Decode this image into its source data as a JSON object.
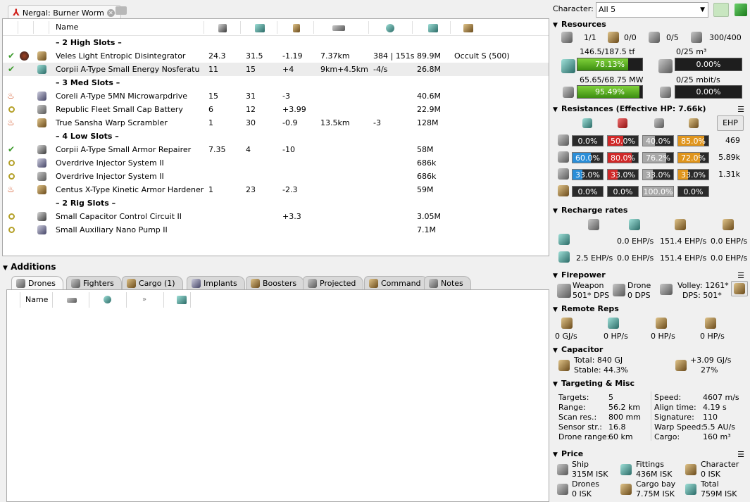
{
  "fit_tab": {
    "title": "Nergal: Burner Worm"
  },
  "columns": {
    "name": "Name"
  },
  "rows": [
    {
      "type": "slot",
      "label": "– 2 High Slots –"
    },
    {
      "type": "mod",
      "state": "ok",
      "name": "Veles Light Entropic Disintegrator",
      "c1": "24.3",
      "c2": "31.5",
      "c3": "-1.19",
      "c4": "7.37km",
      "c5": "384 | 151s",
      "c6": "89.9M",
      "c7": "Occult S (500)"
    },
    {
      "type": "mod",
      "state": "ok",
      "sel": true,
      "name": "Corpii A-Type Small Energy Nosferatu",
      "c1": "11",
      "c2": "15",
      "c3": "+4",
      "c4": "9km+4.5km",
      "c5": "-4/s",
      "c6": "26.8M",
      "c7": ""
    },
    {
      "type": "slot",
      "label": "– 3 Med Slots –"
    },
    {
      "type": "mod",
      "state": "ovl",
      "name": "Coreli A-Type 5MN Microwarpdrive",
      "c1": "15",
      "c2": "31",
      "c3": "-3",
      "c4": "",
      "c5": "",
      "c6": "40.6M",
      "c7": ""
    },
    {
      "type": "mod",
      "state": "off",
      "name": "Republic Fleet Small Cap Battery",
      "c1": "6",
      "c2": "12",
      "c3": "+3.99",
      "c4": "",
      "c5": "",
      "c6": "22.9M",
      "c7": ""
    },
    {
      "type": "mod",
      "state": "ovl",
      "name": "True Sansha Warp Scrambler",
      "c1": "1",
      "c2": "30",
      "c3": "-0.9",
      "c4": "13.5km",
      "c5": "-3",
      "c6": "128M",
      "c7": ""
    },
    {
      "type": "slot",
      "label": "– 4 Low Slots –"
    },
    {
      "type": "mod",
      "state": "ok",
      "name": "Corpii A-Type Small Armor Repairer",
      "c1": "7.35",
      "c2": "4",
      "c3": "-10",
      "c4": "",
      "c5": "",
      "c6": "58M",
      "c7": ""
    },
    {
      "type": "mod",
      "state": "off",
      "name": "Overdrive Injector System II",
      "c1": "",
      "c2": "",
      "c3": "",
      "c4": "",
      "c5": "",
      "c6": "686k",
      "c7": ""
    },
    {
      "type": "mod",
      "state": "off",
      "name": "Overdrive Injector System II",
      "c1": "",
      "c2": "",
      "c3": "",
      "c4": "",
      "c5": "",
      "c6": "686k",
      "c7": ""
    },
    {
      "type": "mod",
      "state": "ovl",
      "name": "Centus X-Type Kinetic Armor Hardener",
      "c1": "1",
      "c2": "23",
      "c3": "-2.3",
      "c4": "",
      "c5": "",
      "c6": "59M",
      "c7": ""
    },
    {
      "type": "slot",
      "label": "– 2 Rig Slots –"
    },
    {
      "type": "mod",
      "state": "off",
      "name": "Small Capacitor Control Circuit II",
      "c1": "",
      "c2": "",
      "c3": "+3.3",
      "c4": "",
      "c5": "",
      "c6": "3.05M",
      "c7": ""
    },
    {
      "type": "mod",
      "state": "off",
      "name": "Small Auxiliary Nano Pump II",
      "c1": "",
      "c2": "",
      "c3": "",
      "c4": "",
      "c5": "",
      "c6": "7.1M",
      "c7": ""
    }
  ],
  "additions": {
    "title": "Additions",
    "tabs": [
      "Drones",
      "Fighters",
      "Cargo (1)",
      "Implants",
      "Boosters",
      "Projected",
      "Command",
      "Notes"
    ],
    "col_name": "Name"
  },
  "character": {
    "label": "Character:",
    "value": "All 5"
  },
  "resources": {
    "title": "Resources",
    "turrets": "1/1",
    "launchers": "0/0",
    "drones": "0/5",
    "calibration": "300/400",
    "cpu_text": "146.5/187.5 tf",
    "cpu_pct": "78.13%",
    "cpu_fill": 0.7813,
    "pg_text": "65.65/68.75 MW",
    "pg_pct": "95.49%",
    "pg_fill": 0.9549,
    "dronebay_text": "0/25 m³",
    "dronebay_pct": "0.00%",
    "bandwidth_text": "0/25 mbit/s",
    "bandwidth_pct": "0.00%"
  },
  "resistances": {
    "title": "Resistances (Effective HP: 7.66k)",
    "ehp_button": "EHP",
    "rows": [
      {
        "vals": [
          "0.0%",
          "50.0%",
          "40.0%",
          "85.0%"
        ],
        "fills": [
          0,
          0.5,
          0.4,
          0.85
        ],
        "hp": "469"
      },
      {
        "vals": [
          "60.0%",
          "80.0%",
          "76.2%",
          "72.0%"
        ],
        "fills": [
          0.6,
          0.8,
          0.762,
          0.72
        ],
        "hp": "5.89k"
      },
      {
        "vals": [
          "33.0%",
          "33.0%",
          "33.0%",
          "33.0%"
        ],
        "fills": [
          0.33,
          0.33,
          0.33,
          0.33
        ],
        "hp": "1.31k"
      },
      {
        "vals": [
          "0.0%",
          "0.0%",
          "100.0%",
          "0.0%"
        ],
        "fills": [
          0,
          0,
          1,
          0
        ],
        "hp": ""
      }
    ],
    "colors": [
      "#2a8ed8",
      "#d02828",
      "#a8a8a8",
      "#e0951c"
    ]
  },
  "recharge": {
    "title": "Recharge rates",
    "r1": [
      "0.0 EHP/s",
      "151.4 EHP/s",
      "0.0 EHP/s"
    ],
    "r2": [
      "2.5 EHP/s",
      "0.0 EHP/s",
      "151.4 EHP/s",
      "0.0 EHP/s"
    ]
  },
  "firepower": {
    "title": "Firepower",
    "weapon_label": "Weapon",
    "weapon_val": "501* DPS",
    "drone_label": "Drone",
    "drone_val": "0 DPS",
    "volley": "Volley: 1261*",
    "dps": "DPS: 501*"
  },
  "remote_reps": {
    "title": "Remote Reps",
    "vals": [
      "0 GJ/s",
      "0 HP/s",
      "0 HP/s",
      "0 HP/s"
    ]
  },
  "capacitor": {
    "title": "Capacitor",
    "total": "Total:  840 GJ",
    "stable": "Stable: 44.3%",
    "delta": "+3.09 GJ/s",
    "delta_pct": "27%"
  },
  "targeting": {
    "title": "Targeting & Misc",
    "left": [
      [
        "Targets:",
        "5"
      ],
      [
        "Range:",
        "56.2 km"
      ],
      [
        "Scan res.:",
        "800 mm"
      ],
      [
        "Sensor str.:",
        "16.8"
      ],
      [
        "Drone range:",
        "60 km"
      ]
    ],
    "right": [
      [
        "Speed:",
        "4607 m/s"
      ],
      [
        "Align time:",
        "4.19 s"
      ],
      [
        "Signature:",
        "110"
      ],
      [
        "Warp Speed:",
        "5.5 AU/s"
      ],
      [
        "Cargo:",
        "160 m³"
      ]
    ]
  },
  "price": {
    "title": "Price",
    "items": [
      [
        "Ship",
        "315M ISK"
      ],
      [
        "Fittings",
        "436M ISK"
      ],
      [
        "Character",
        "0 ISK"
      ],
      [
        "Drones",
        "0 ISK"
      ],
      [
        "Cargo bay",
        "7.75M ISK"
      ],
      [
        "Total",
        "759M ISK"
      ]
    ]
  }
}
